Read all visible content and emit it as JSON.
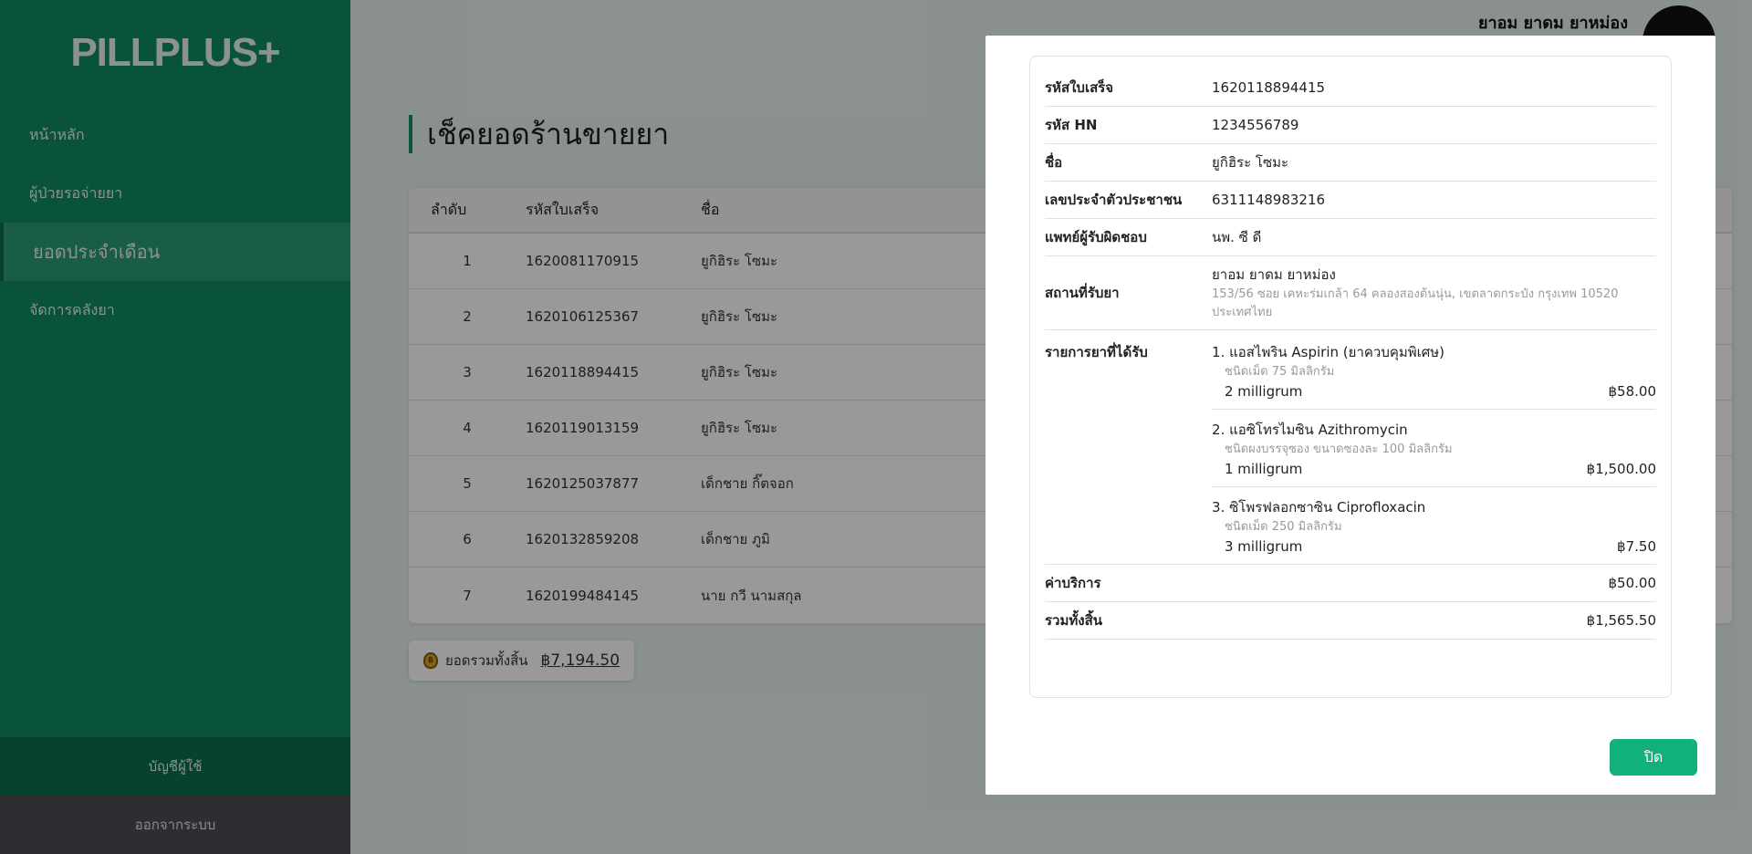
{
  "app": {
    "logo": "PILLPLUS+"
  },
  "sidebar": {
    "items": [
      {
        "label": "หน้าหลัก"
      },
      {
        "label": "ผู้ป่วยรอจ่ายยา"
      },
      {
        "label": "ยอดประจำเดือน"
      },
      {
        "label": "จัดการคลังยา"
      }
    ],
    "account_label": "บัญชีผู้ใช้",
    "logout_label": "ออกจากระบบ"
  },
  "header": {
    "user_name": "ยาอม ยาดม ยาหม่อง"
  },
  "page": {
    "title": "เช็คยอดร้านขายยา",
    "table": {
      "columns": [
        "ลำดับ",
        "รหัสใบเสร็จ",
        "ชื่อ"
      ],
      "rows": [
        {
          "no": "1",
          "receipt": "1620081170915",
          "name": "ยูกิฮิระ โซมะ"
        },
        {
          "no": "2",
          "receipt": "1620106125367",
          "name": "ยูกิฮิระ โซมะ"
        },
        {
          "no": "3",
          "receipt": "1620118894415",
          "name": "ยูกิฮิระ โซมะ"
        },
        {
          "no": "4",
          "receipt": "1620119013159",
          "name": "ยูกิฮิระ โซมะ"
        },
        {
          "no": "5",
          "receipt": "1620125037877",
          "name": "เด็กชาย กิ๊ตจอก"
        },
        {
          "no": "6",
          "receipt": "1620132859208",
          "name": "เด็กชาย ภูมิ"
        },
        {
          "no": "7",
          "receipt": "1620199484145",
          "name": "นาย กวี นามสกุล"
        }
      ]
    },
    "total": {
      "label": "ยอดรวมทั้งสิ้น",
      "amount": "฿7,194.50"
    }
  },
  "modal": {
    "fields": {
      "receipt": {
        "label": "รหัสใบเสร็จ",
        "value": "1620118894415"
      },
      "hn": {
        "label": "รหัส HN",
        "value": "1234556789"
      },
      "name": {
        "label": "ชื่อ",
        "value": "ยูกิฮิระ โซมะ"
      },
      "citizen_id": {
        "label": "เลขประจำตัวประชาชน",
        "value": "6311148983216"
      },
      "doctor": {
        "label": "แพทย์ผู้รับผิดชอบ",
        "value": "นพ. ซี ดี"
      },
      "pickup": {
        "label": "สถานที่รับยา",
        "value": "ยาอม ยาดม ยาหม่อง",
        "address": "153/56 ซอย เคหะร่มเกล้า 64 คลองสองต้นนุ่น, เขตลาดกระบัง กรุงเทพ 10520 ประเทศไทย"
      }
    },
    "meds_label": "รายการยาที่ได้รับ",
    "meds": [
      {
        "name": "1. แอสไพริน Aspirin (ยาควบคุมพิเศษ)",
        "detail": "ชนิดเม็ด 75 มิลลิกรัม",
        "qty": "2 milligrum",
        "price": "฿58.00"
      },
      {
        "name": "2. แอซิโทรไมซิน Azithromycin",
        "detail": "ชนิดผงบรรจุซอง ขนาดซองละ 100 มิลลิกรัม",
        "qty": "1 milligrum",
        "price": "฿1,500.00"
      },
      {
        "name": "3. ซิโพรฟลอกซาซิน Ciprofloxacin",
        "detail": "ชนิดเม็ด 250 มิลลิกรัม",
        "qty": "3 milligrum",
        "price": "฿7.50"
      }
    ],
    "service_fee": {
      "label": "ค่าบริการ",
      "value": "฿50.00"
    },
    "grand_total": {
      "label": "รวมทั้งสิ้น",
      "value": "฿1,565.50"
    },
    "close_label": "ปิด"
  }
}
